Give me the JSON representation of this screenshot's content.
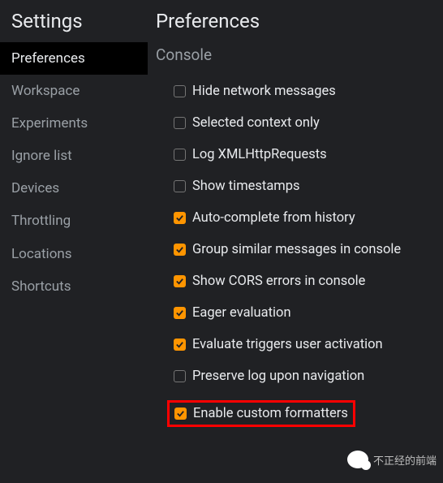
{
  "sidebar": {
    "title": "Settings",
    "items": [
      {
        "label": "Preferences",
        "active": true
      },
      {
        "label": "Workspace",
        "active": false
      },
      {
        "label": "Experiments",
        "active": false
      },
      {
        "label": "Ignore list",
        "active": false
      },
      {
        "label": "Devices",
        "active": false
      },
      {
        "label": "Throttling",
        "active": false
      },
      {
        "label": "Locations",
        "active": false
      },
      {
        "label": "Shortcuts",
        "active": false
      }
    ]
  },
  "main": {
    "title": "Preferences",
    "section": "Console",
    "options": [
      {
        "label": "Hide network messages",
        "checked": false
      },
      {
        "label": "Selected context only",
        "checked": false
      },
      {
        "label": "Log XMLHttpRequests",
        "checked": false
      },
      {
        "label": "Show timestamps",
        "checked": false
      },
      {
        "label": "Auto-complete from history",
        "checked": true
      },
      {
        "label": "Group similar messages in console",
        "checked": true
      },
      {
        "label": "Show CORS errors in console",
        "checked": true
      },
      {
        "label": "Eager evaluation",
        "checked": true
      },
      {
        "label": "Evaluate triggers user activation",
        "checked": true
      },
      {
        "label": "Preserve log upon navigation",
        "checked": false
      },
      {
        "label": "Enable custom formatters",
        "checked": true,
        "highlighted": true
      }
    ]
  },
  "watermark": {
    "text": "不正经的前端"
  }
}
